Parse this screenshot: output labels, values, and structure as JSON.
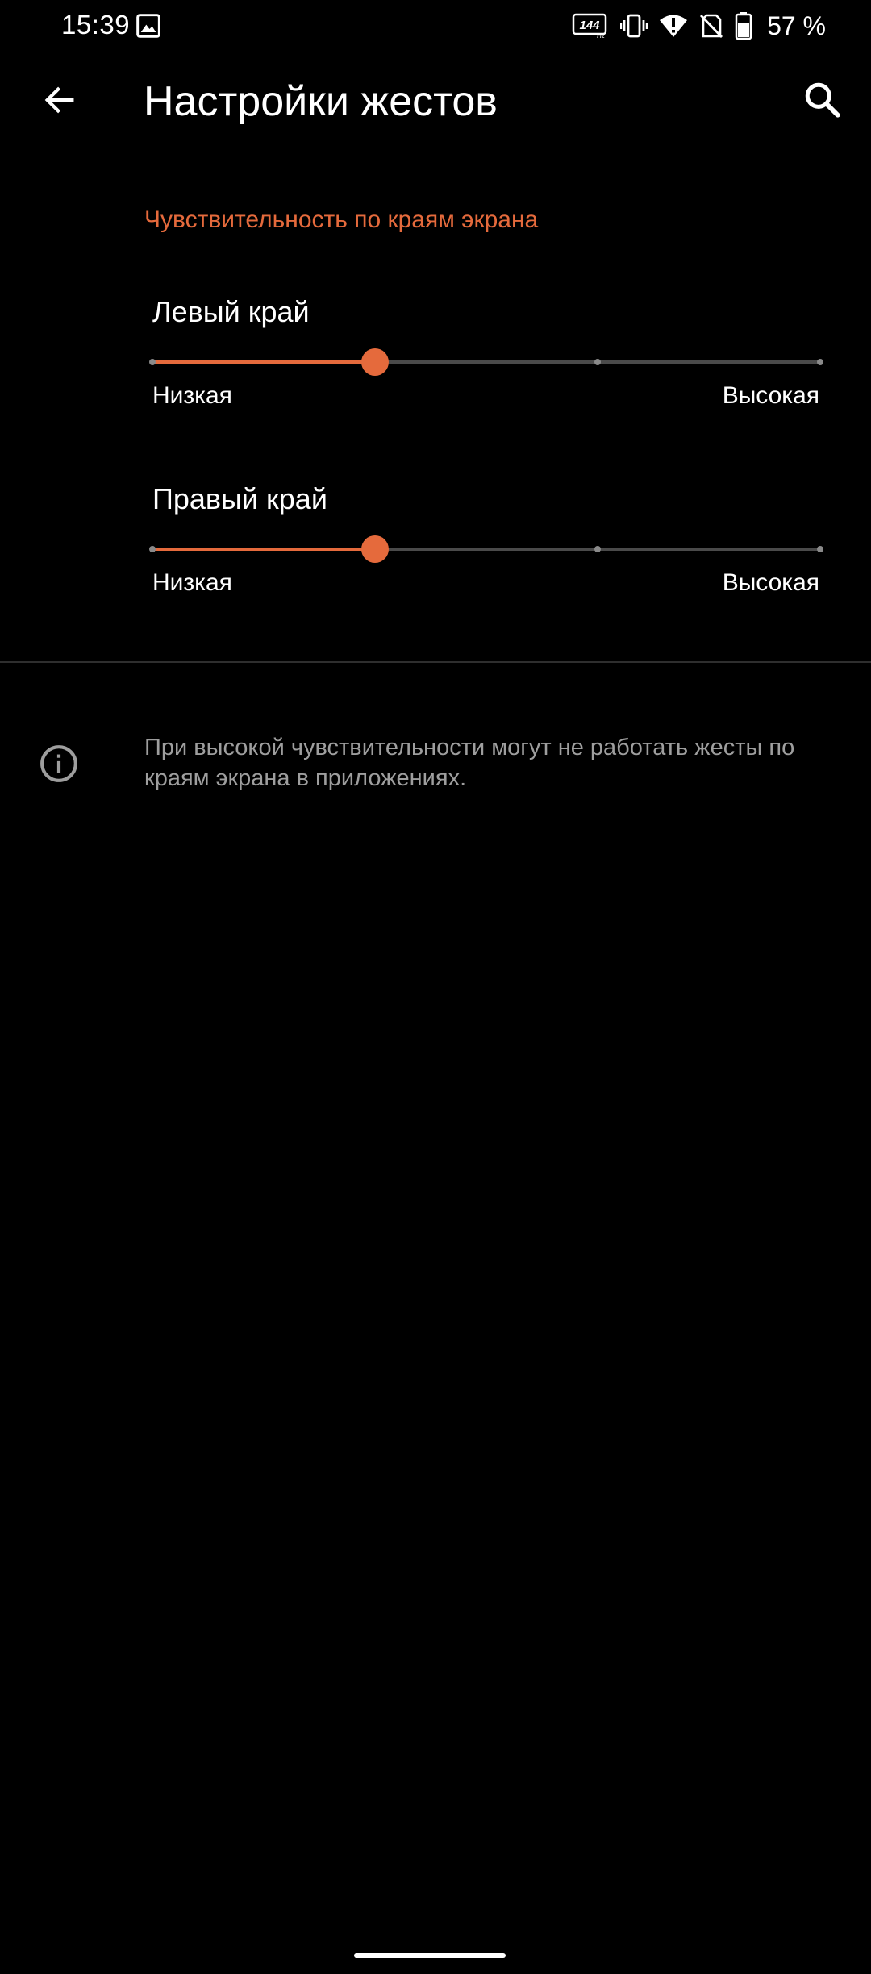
{
  "status_bar": {
    "time": "15:39",
    "refresh_rate": "144",
    "refresh_unit": "Hz",
    "battery": "57 %",
    "icons": [
      "gallery-icon",
      "refresh-rate-icon",
      "vibrate-icon",
      "wifi-icon",
      "no-sim-icon",
      "battery-icon"
    ]
  },
  "toolbar": {
    "title": "Настройки жестов",
    "back_icon": "arrow-left-icon",
    "search_icon": "search-icon"
  },
  "section": {
    "title": "Чувствительность по краям экрана"
  },
  "sliders": [
    {
      "label": "Левый край",
      "min_label": "Низкая",
      "max_label": "Высокая",
      "steps": 4,
      "value_index": 1
    },
    {
      "label": "Правый край",
      "min_label": "Низкая",
      "max_label": "Высокая",
      "steps": 4,
      "value_index": 1
    }
  ],
  "info": {
    "icon": "info-icon",
    "text": "При высокой чувствительности могут не работать жесты по краям экрана в приложениях."
  },
  "colors": {
    "accent": "#e56a3c",
    "background": "#000000",
    "secondary_text": "#9e9e9e"
  }
}
